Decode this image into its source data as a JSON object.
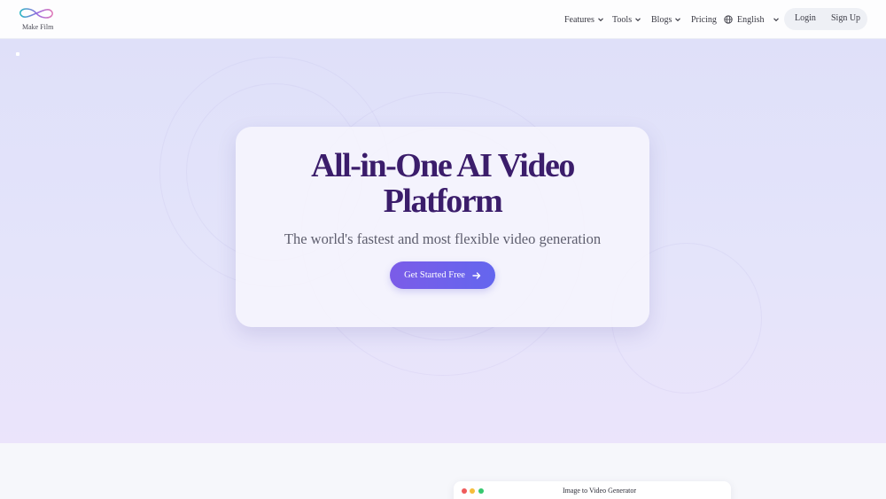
{
  "brand": {
    "name": "Make Film",
    "logo_colors": [
      "#2ab7c4",
      "#9b6ae0",
      "#e07ab8"
    ]
  },
  "nav": {
    "items": [
      {
        "label": "Features",
        "has_dropdown": true
      },
      {
        "label": "Tools",
        "has_dropdown": true
      },
      {
        "label": "Blogs",
        "has_dropdown": true
      },
      {
        "label": "Pricing",
        "has_dropdown": false
      }
    ],
    "language": {
      "label": "English",
      "icon": "globe-icon"
    },
    "login_label": "Login",
    "signup_label": "Sign Up"
  },
  "hero": {
    "title_line1": "All-in-One AI Video",
    "title_line2": "Platform",
    "subtitle": "The world's fastest and most flexible video generation",
    "cta_label": "Get Started Free",
    "cta_icon": "arrow-right-icon",
    "colors": {
      "title": "#3b1d6b",
      "cta_start": "#7b5ce8",
      "cta_end": "#6466ee"
    }
  },
  "preview": {
    "window_title": "Image to Video Generator",
    "dot_colors": [
      "#ef5b5b",
      "#f5bd3a",
      "#37c86f"
    ]
  }
}
